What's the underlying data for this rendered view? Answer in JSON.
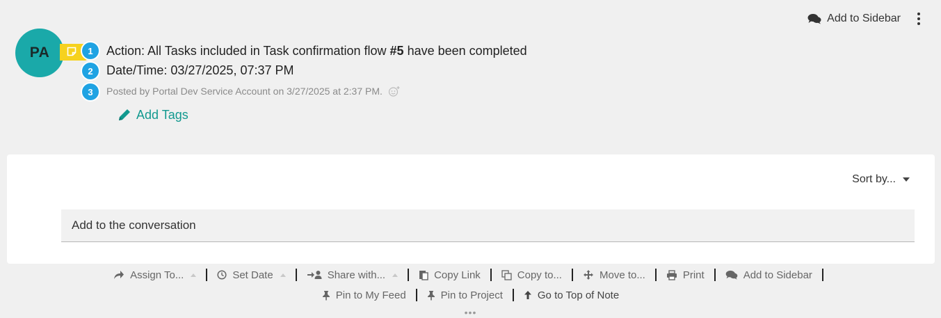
{
  "header": {
    "add_to_sidebar_label": "Add to Sidebar",
    "more_menu_icon": "kebab-vertical-icon"
  },
  "post": {
    "avatar_initials": "PA",
    "badges": [
      "1",
      "2",
      "3"
    ],
    "action_prefix": "Action: All Tasks included in Task confirmation flow ",
    "action_flow_number": "#5",
    "action_suffix": " have been completed",
    "datetime_text": "Date/Time: 03/27/2025, 07:37 PM",
    "posted_by_text": "Posted by Portal Dev Service Account on 3/27/2025 at 2:37 PM.",
    "add_tags_label": "Add Tags"
  },
  "comments": {
    "sort_label": "Sort by...",
    "input_placeholder": "Add to the conversation"
  },
  "toolbar": {
    "assign_to": "Assign To...",
    "set_date": "Set Date",
    "share_with": "Share with...",
    "copy_link": "Copy Link",
    "copy_to": "Copy to...",
    "move_to": "Move to...",
    "print": "Print",
    "add_to_sidebar": "Add to Sidebar",
    "pin_to_my_feed": "Pin to My Feed",
    "pin_to_project": "Pin to Project",
    "go_to_top": "Go to Top of Note",
    "more": "•••"
  },
  "colors": {
    "avatar": "#1aa9a9",
    "note_tag": "#f6d21e",
    "badge": "#1fa3e3",
    "link_teal": "#12998f"
  }
}
